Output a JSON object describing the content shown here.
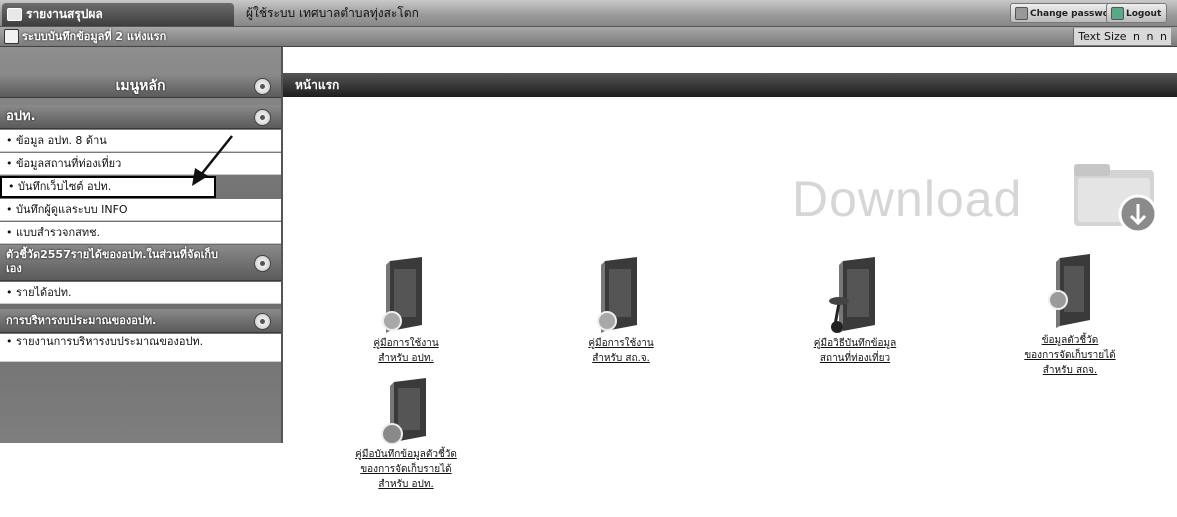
{
  "top_bar": {
    "active_tab": "รายงานสรุปผล",
    "user_label": "ผู้ใช้ระบบ เทศบาลตำบลทุ่งสะโตก",
    "change_password": "Change password",
    "logout": "Logout"
  },
  "second_bar": {
    "breadcrumb": "ระบบบันทึกข้อมูลที่ 2 แห่งแรก",
    "text_size_label": "Text Size",
    "text_size_options": [
      "n",
      "n",
      "n"
    ]
  },
  "sidebar": {
    "main_menu": "เมนูหลัก",
    "section_1": "อปท.",
    "section_1_items": [
      "• ข้อมูล อปท. 8 ด้าน",
      "• ข้อมูลสถานที่ท่องเที่ยว",
      "• บันทึกเว็บไซต์ อปท.",
      "• บันทึกผู้ดูแลระบบ INFO",
      "• แบบสำรวจกสทช."
    ],
    "section_2": "ตัวชี้วัด2557รายได้ของอปท.ในส่วนที่จัดเก็บเอง",
    "section_2_items": [
      "• รายได้อปท."
    ],
    "section_3": "การบริหารงบประมาณของอปท.",
    "section_3_items": [
      "• รายงานการบริหารงบประมาณของอปท."
    ]
  },
  "content": {
    "header": "หน้าแรก",
    "download_text": "Download",
    "manuals": [
      {
        "line1": "คู่มือการใช้งาน",
        "line2": "สำหรับ อปท.",
        "line3": ""
      },
      {
        "line1": "คู่มือการใช้งาน",
        "line2": "สำหรับ สถ.จ.",
        "line3": ""
      },
      {
        "line1": "คู่มือวิธีบันทึกข้อมูล",
        "line2": "สถานที่ท่องเที่ยว",
        "line3": ""
      },
      {
        "line1": "ข้อมูลตัวชี้วัด",
        "line2": "ของการจัดเก็บรายได้",
        "line3": "สำหรับ สถจ."
      },
      {
        "line1": "คู่มือบันทึกข้อมูลตัวชี้วัด",
        "line2": "ของการจัดเก็บรายได้",
        "line3": "สำหรับ อปท."
      }
    ]
  },
  "colors": {
    "header_dark": "#1e1e1e",
    "sidebar_gray": "#7a7a7a",
    "download_gray": "#d6d6d6"
  }
}
